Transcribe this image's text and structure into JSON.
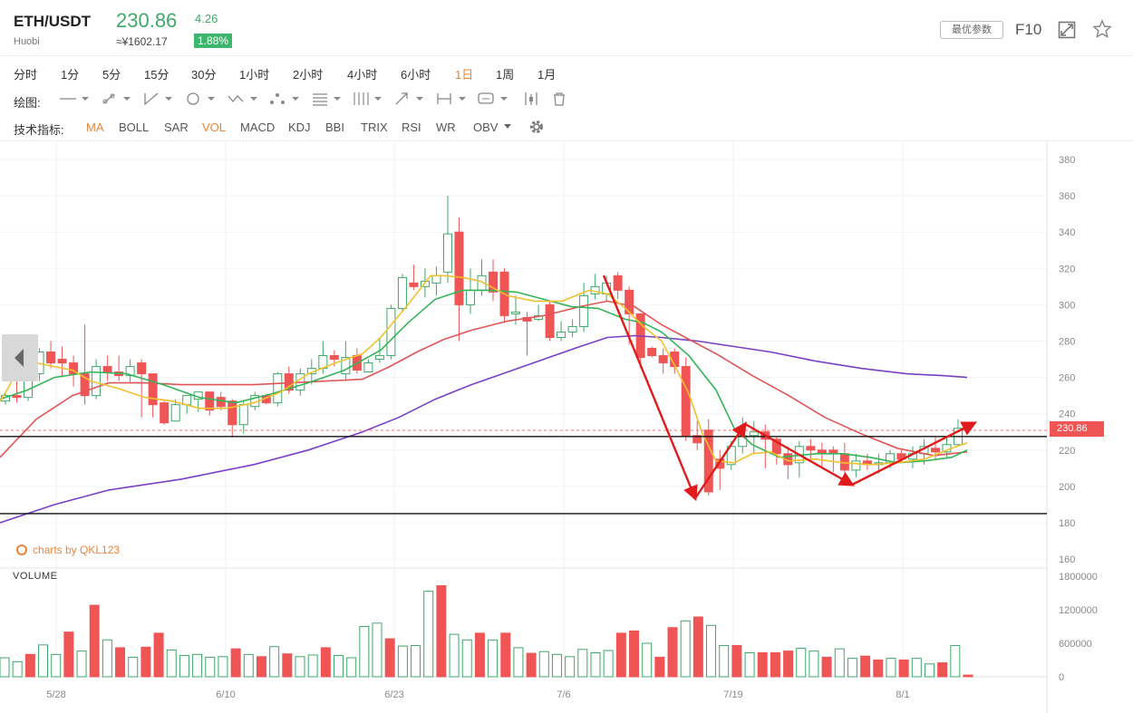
{
  "header": {
    "symbol": "ETH/USDT",
    "exchange": "Huobi",
    "price": "230.86",
    "cny_price": "≈¥1602.17",
    "change": "4.26",
    "change_pct": "1.88%",
    "param_button": "最优参数",
    "f10": "F10",
    "expand_icon": "expand-icon",
    "star_icon": "star-icon"
  },
  "periods": [
    "分时",
    "1分",
    "5分",
    "15分",
    "30分",
    "1小时",
    "2小时",
    "4小时",
    "6小时",
    "1日",
    "1周",
    "1月"
  ],
  "active_period": "1日",
  "drawing": {
    "label": "绘图:"
  },
  "indicators": {
    "label": "技术指标:",
    "items": [
      "MA",
      "BOLL",
      "SAR",
      "VOL",
      "MACD",
      "KDJ",
      "BBI",
      "TRIX",
      "RSI",
      "WR",
      "OBV"
    ],
    "active": [
      "MA",
      "VOL"
    ]
  },
  "watermark": "charts by QKL123",
  "volume_label": "VOLUME",
  "colors": {
    "up": "#3fa86a",
    "down": "#f05555",
    "accent": "#e9853a",
    "ma5": "#f2c12e",
    "ma10": "#34b45a",
    "ma20": "#e05555",
    "ma60": "#7a3fc7"
  },
  "chart_data": {
    "type": "candlestick",
    "x_ticks": [
      "5/28",
      "6/10",
      "6/23",
      "7/6",
      "7/19",
      "8/1"
    ],
    "price_axis": {
      "ticks": [
        380,
        360,
        340,
        320,
        300,
        280,
        260,
        240,
        220,
        200,
        180,
        160
      ],
      "range": [
        160,
        385
      ]
    },
    "volume_axis": {
      "ticks": [
        1800000,
        1200000,
        600000,
        0
      ],
      "range": [
        0,
        1800000
      ]
    },
    "last_price": 230.86,
    "horizontal_lines": [
      227.5,
      185
    ],
    "candles": [
      [
        247,
        252,
        245,
        250
      ],
      [
        250,
        258,
        246,
        249
      ],
      [
        249,
        265,
        247,
        262
      ],
      [
        262,
        276,
        258,
        274
      ],
      [
        274,
        280,
        265,
        268
      ],
      [
        270,
        277,
        260,
        268
      ],
      [
        268,
        272,
        255,
        262
      ],
      [
        262,
        289,
        245,
        250
      ],
      [
        250,
        270,
        248,
        266
      ],
      [
        266,
        272,
        258,
        263
      ],
      [
        263,
        272,
        258,
        261
      ],
      [
        261,
        270,
        257,
        266
      ],
      [
        268,
        270,
        238,
        262
      ],
      [
        262,
        258,
        238,
        245
      ],
      [
        246,
        247,
        234,
        235
      ],
      [
        236,
        248,
        240,
        245
      ],
      [
        245,
        250,
        240,
        250
      ],
      [
        248,
        252,
        241,
        252
      ],
      [
        252,
        249,
        239,
        242
      ],
      [
        249,
        252,
        242,
        244
      ],
      [
        247,
        248,
        227,
        234
      ],
      [
        234,
        247,
        229,
        245
      ],
      [
        244,
        252,
        242,
        250
      ],
      [
        250,
        251,
        245,
        246
      ],
      [
        246,
        263,
        244,
        262
      ],
      [
        262,
        266,
        251,
        253
      ],
      [
        253,
        265,
        250,
        262
      ],
      [
        262,
        270,
        256,
        265
      ],
      [
        265,
        280,
        262,
        272
      ],
      [
        272,
        275,
        266,
        270
      ],
      [
        262,
        280,
        258,
        271
      ],
      [
        272,
        276,
        262,
        264
      ],
      [
        263,
        270,
        263,
        268
      ],
      [
        270,
        282,
        268,
        272
      ],
      [
        272,
        300,
        270,
        298
      ],
      [
        298,
        317,
        296,
        315
      ],
      [
        312,
        322,
        308,
        310
      ],
      [
        310,
        320,
        304,
        313
      ],
      [
        312,
        321,
        305,
        316
      ],
      [
        318,
        360,
        312,
        339
      ],
      [
        340,
        348,
        280,
        300
      ],
      [
        300,
        320,
        295,
        308
      ],
      [
        308,
        325,
        305,
        316
      ],
      [
        318,
        325,
        302,
        307
      ],
      [
        318,
        320,
        290,
        294
      ],
      [
        295,
        305,
        289,
        296
      ],
      [
        293,
        296,
        272,
        291
      ],
      [
        292,
        300,
        291,
        294
      ],
      [
        300,
        302,
        280,
        282
      ],
      [
        282,
        291,
        280,
        285
      ],
      [
        285,
        292,
        282,
        288
      ],
      [
        288,
        312,
        285,
        305
      ],
      [
        306,
        317,
        303,
        310
      ],
      [
        306,
        316,
        302,
        312
      ],
      [
        316,
        318,
        303,
        308
      ],
      [
        308,
        310,
        278,
        295
      ],
      [
        295,
        290,
        265,
        271
      ],
      [
        276,
        277,
        271,
        272
      ],
      [
        272,
        276,
        262,
        268
      ],
      [
        274,
        276,
        262,
        266
      ],
      [
        266,
        271,
        225,
        228
      ],
      [
        228,
        236,
        220,
        224
      ],
      [
        231,
        237,
        195,
        197
      ],
      [
        215,
        220,
        198,
        210
      ],
      [
        212,
        225,
        209,
        222
      ],
      [
        222,
        238,
        218,
        228
      ],
      [
        228,
        236,
        218,
        230
      ],
      [
        230,
        234,
        210,
        226
      ],
      [
        226,
        227,
        212,
        218
      ],
      [
        218,
        222,
        204,
        212
      ],
      [
        213,
        225,
        205,
        222
      ],
      [
        222,
        226,
        215,
        220
      ],
      [
        220,
        224,
        210,
        218
      ],
      [
        220,
        222,
        208,
        218
      ],
      [
        218,
        224,
        204,
        209
      ],
      [
        209,
        218,
        205,
        214
      ],
      [
        214,
        218,
        209,
        212
      ],
      [
        212,
        218,
        207,
        213
      ],
      [
        213,
        220,
        210,
        218
      ],
      [
        218,
        220,
        213,
        215
      ],
      [
        215,
        222,
        210,
        218
      ],
      [
        218,
        226,
        212,
        222
      ],
      [
        221,
        227,
        215,
        219
      ],
      [
        219,
        227,
        216,
        223
      ],
      [
        223,
        237,
        222,
        232
      ]
    ],
    "volume": [
      [
        "up",
        340000
      ],
      [
        "up",
        270000
      ],
      [
        "down",
        400000
      ],
      [
        "up",
        570000
      ],
      [
        "up",
        400000
      ],
      [
        "down",
        800000
      ],
      [
        "up",
        460000
      ],
      [
        "down",
        1280000
      ],
      [
        "up",
        660000
      ],
      [
        "down",
        520000
      ],
      [
        "up",
        350000
      ],
      [
        "down",
        530000
      ],
      [
        "down",
        780000
      ],
      [
        "up",
        480000
      ],
      [
        "up",
        380000
      ],
      [
        "up",
        400000
      ],
      [
        "up",
        350000
      ],
      [
        "up",
        360000
      ],
      [
        "down",
        500000
      ],
      [
        "up",
        400000
      ],
      [
        "down",
        360000
      ],
      [
        "up",
        540000
      ],
      [
        "down",
        410000
      ],
      [
        "up",
        360000
      ],
      [
        "up",
        390000
      ],
      [
        "down",
        520000
      ],
      [
        "up",
        380000
      ],
      [
        "up",
        340000
      ],
      [
        "up",
        900000
      ],
      [
        "up",
        960000
      ],
      [
        "down",
        680000
      ],
      [
        "up",
        550000
      ],
      [
        "up",
        560000
      ],
      [
        "up",
        1530000
      ],
      [
        "down",
        1630000
      ],
      [
        "up",
        760000
      ],
      [
        "up",
        660000
      ],
      [
        "down",
        780000
      ],
      [
        "up",
        660000
      ],
      [
        "down",
        780000
      ],
      [
        "up",
        520000
      ],
      [
        "down",
        420000
      ],
      [
        "up",
        450000
      ],
      [
        "up",
        400000
      ],
      [
        "up",
        360000
      ],
      [
        "up",
        490000
      ],
      [
        "up",
        430000
      ],
      [
        "up",
        470000
      ],
      [
        "down",
        780000
      ],
      [
        "down",
        820000
      ],
      [
        "up",
        600000
      ],
      [
        "down",
        350000
      ],
      [
        "down",
        880000
      ],
      [
        "up",
        1000000
      ],
      [
        "down",
        1070000
      ],
      [
        "up",
        920000
      ],
      [
        "up",
        560000
      ],
      [
        "down",
        560000
      ],
      [
        "up",
        430000
      ],
      [
        "down",
        430000
      ],
      [
        "down",
        430000
      ],
      [
        "down",
        460000
      ],
      [
        "up",
        510000
      ],
      [
        "up",
        460000
      ],
      [
        "down",
        350000
      ],
      [
        "up",
        500000
      ],
      [
        "up",
        330000
      ],
      [
        "down",
        370000
      ],
      [
        "down",
        300000
      ],
      [
        "up",
        330000
      ],
      [
        "down",
        300000
      ],
      [
        "up",
        330000
      ],
      [
        "up",
        230000
      ],
      [
        "down",
        250000
      ],
      [
        "up",
        560000
      ],
      [
        "down",
        30000
      ]
    ],
    "ma_series": {
      "ma5": [
        [
          0,
          247
        ],
        [
          10,
          255
        ],
        [
          20,
          267
        ],
        [
          40,
          268
        ],
        [
          60,
          266
        ],
        [
          80,
          264
        ],
        [
          100,
          258
        ],
        [
          130,
          254
        ],
        [
          160,
          249
        ],
        [
          190,
          247
        ],
        [
          220,
          243
        ],
        [
          250,
          243
        ],
        [
          280,
          246
        ],
        [
          310,
          252
        ],
        [
          340,
          262
        ],
        [
          370,
          268
        ],
        [
          400,
          273
        ],
        [
          420,
          282
        ],
        [
          450,
          300
        ],
        [
          475,
          316
        ],
        [
          490,
          316
        ],
        [
          510,
          315
        ],
        [
          530,
          313
        ],
        [
          560,
          305
        ],
        [
          590,
          302
        ],
        [
          620,
          302
        ],
        [
          650,
          308
        ],
        [
          670,
          306
        ],
        [
          690,
          298
        ],
        [
          710,
          288
        ],
        [
          730,
          280
        ],
        [
          745,
          266
        ],
        [
          760,
          251
        ],
        [
          775,
          229
        ],
        [
          790,
          214
        ],
        [
          810,
          213
        ],
        [
          830,
          218
        ],
        [
          850,
          219
        ],
        [
          870,
          214
        ],
        [
          900,
          215
        ],
        [
          930,
          213
        ],
        [
          960,
          212
        ],
        [
          990,
          213
        ],
        [
          1020,
          215
        ],
        [
          1050,
          221
        ],
        [
          1067,
          224
        ]
      ],
      "ma10": [
        [
          0,
          248
        ],
        [
          30,
          253
        ],
        [
          60,
          260
        ],
        [
          100,
          263
        ],
        [
          140,
          262
        ],
        [
          180,
          256
        ],
        [
          220,
          249
        ],
        [
          260,
          246
        ],
        [
          300,
          251
        ],
        [
          340,
          257
        ],
        [
          380,
          264
        ],
        [
          420,
          275
        ],
        [
          450,
          290
        ],
        [
          480,
          303
        ],
        [
          510,
          308
        ],
        [
          540,
          308
        ],
        [
          570,
          307
        ],
        [
          600,
          303
        ],
        [
          630,
          299
        ],
        [
          660,
          298
        ],
        [
          690,
          292
        ],
        [
          710,
          290
        ],
        [
          730,
          285
        ],
        [
          760,
          272
        ],
        [
          790,
          253
        ],
        [
          810,
          232
        ],
        [
          830,
          223
        ],
        [
          860,
          216
        ],
        [
          900,
          218
        ],
        [
          930,
          218
        ],
        [
          960,
          216
        ],
        [
          990,
          213
        ],
        [
          1020,
          214
        ],
        [
          1050,
          216
        ],
        [
          1067,
          220
        ]
      ],
      "ma20": [
        [
          0,
          216
        ],
        [
          40,
          237
        ],
        [
          80,
          250
        ],
        [
          120,
          257
        ],
        [
          160,
          257
        ],
        [
          200,
          256
        ],
        [
          240,
          256
        ],
        [
          280,
          256
        ],
        [
          320,
          257
        ],
        [
          360,
          258
        ],
        [
          400,
          259
        ],
        [
          430,
          266
        ],
        [
          460,
          274
        ],
        [
          490,
          281
        ],
        [
          520,
          286
        ],
        [
          560,
          291
        ],
        [
          600,
          294
        ],
        [
          640,
          299
        ],
        [
          670,
          302
        ],
        [
          700,
          299
        ],
        [
          730,
          289
        ],
        [
          760,
          281
        ],
        [
          790,
          273
        ],
        [
          830,
          261
        ],
        [
          870,
          250
        ],
        [
          910,
          238
        ],
        [
          950,
          229
        ],
        [
          990,
          221
        ],
        [
          1030,
          217
        ],
        [
          1067,
          219
        ]
      ],
      "ma60": [
        [
          0,
          180
        ],
        [
          60,
          190
        ],
        [
          120,
          198
        ],
        [
          200,
          204
        ],
        [
          280,
          212
        ],
        [
          340,
          220
        ],
        [
          400,
          230
        ],
        [
          440,
          238
        ],
        [
          480,
          248
        ],
        [
          520,
          256
        ],
        [
          560,
          263
        ],
        [
          600,
          270
        ],
        [
          640,
          277
        ],
        [
          670,
          282
        ],
        [
          700,
          283
        ],
        [
          730,
          282
        ],
        [
          770,
          280
        ],
        [
          810,
          277
        ],
        [
          850,
          274
        ],
        [
          900,
          269
        ],
        [
          950,
          265
        ],
        [
          1000,
          262
        ],
        [
          1040,
          261
        ],
        [
          1067,
          260
        ]
      ]
    }
  }
}
